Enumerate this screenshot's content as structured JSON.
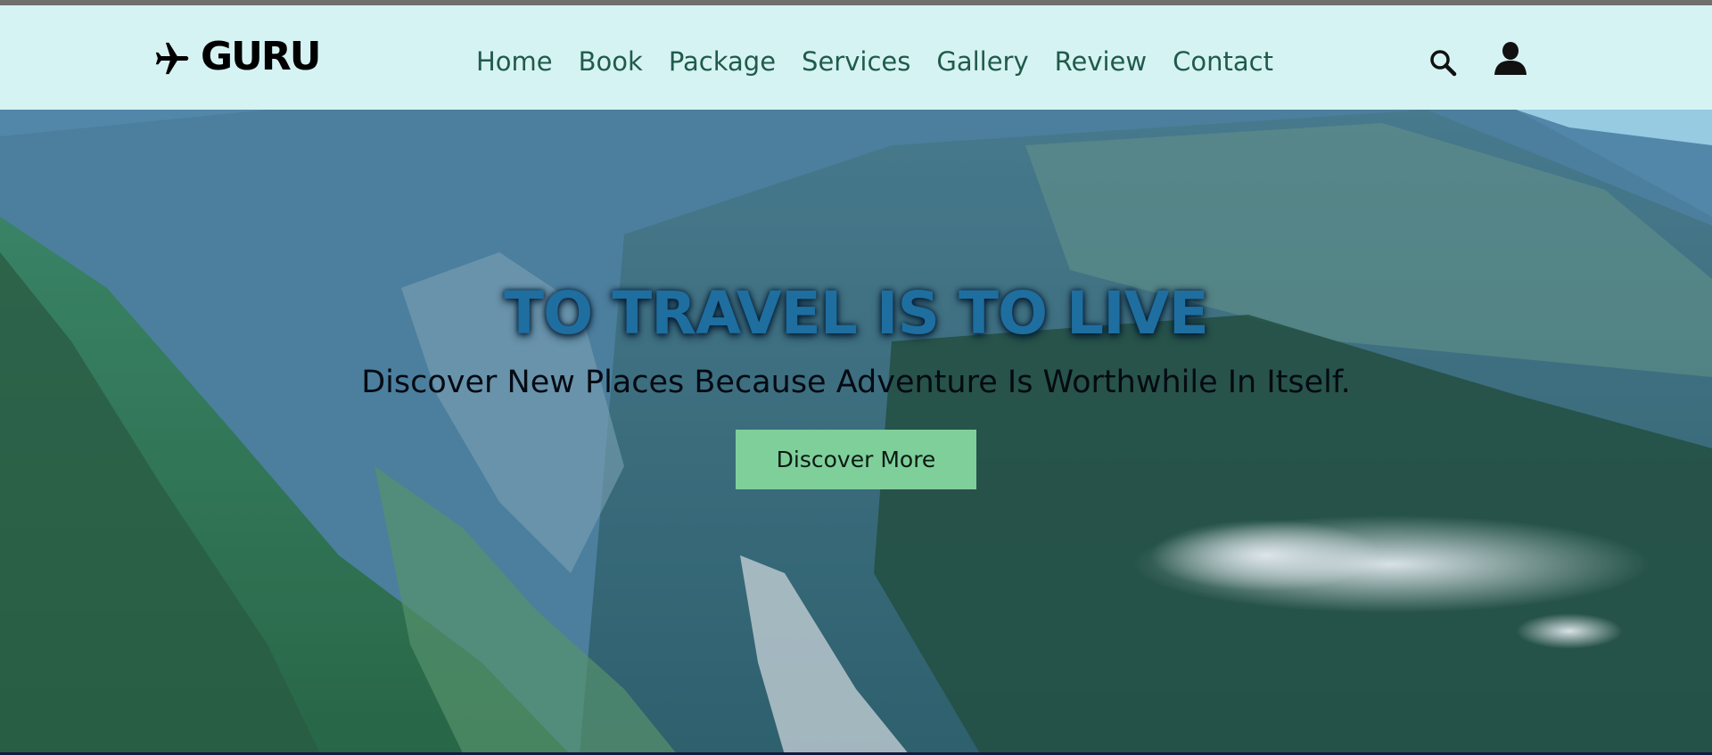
{
  "brand": {
    "name": "GURU",
    "icon": "airplane-icon"
  },
  "nav": {
    "items": [
      {
        "label": "Home"
      },
      {
        "label": "Book"
      },
      {
        "label": "Package"
      },
      {
        "label": "Services"
      },
      {
        "label": "Gallery"
      },
      {
        "label": "Review"
      },
      {
        "label": "Contact"
      }
    ],
    "search_icon": "search-icon",
    "user_icon": "user-icon"
  },
  "hero": {
    "title": "TO TRAVEL IS TO LIVE",
    "subtitle": "Discover New Places Because Adventure Is Worthwhile In Itself.",
    "cta_label": "Discover More"
  },
  "colors": {
    "navbar_bg": "#d6f3f3",
    "nav_text": "#1f5b4b",
    "title": "#1f6ea0",
    "cta_bg": "#7fcf9a"
  }
}
